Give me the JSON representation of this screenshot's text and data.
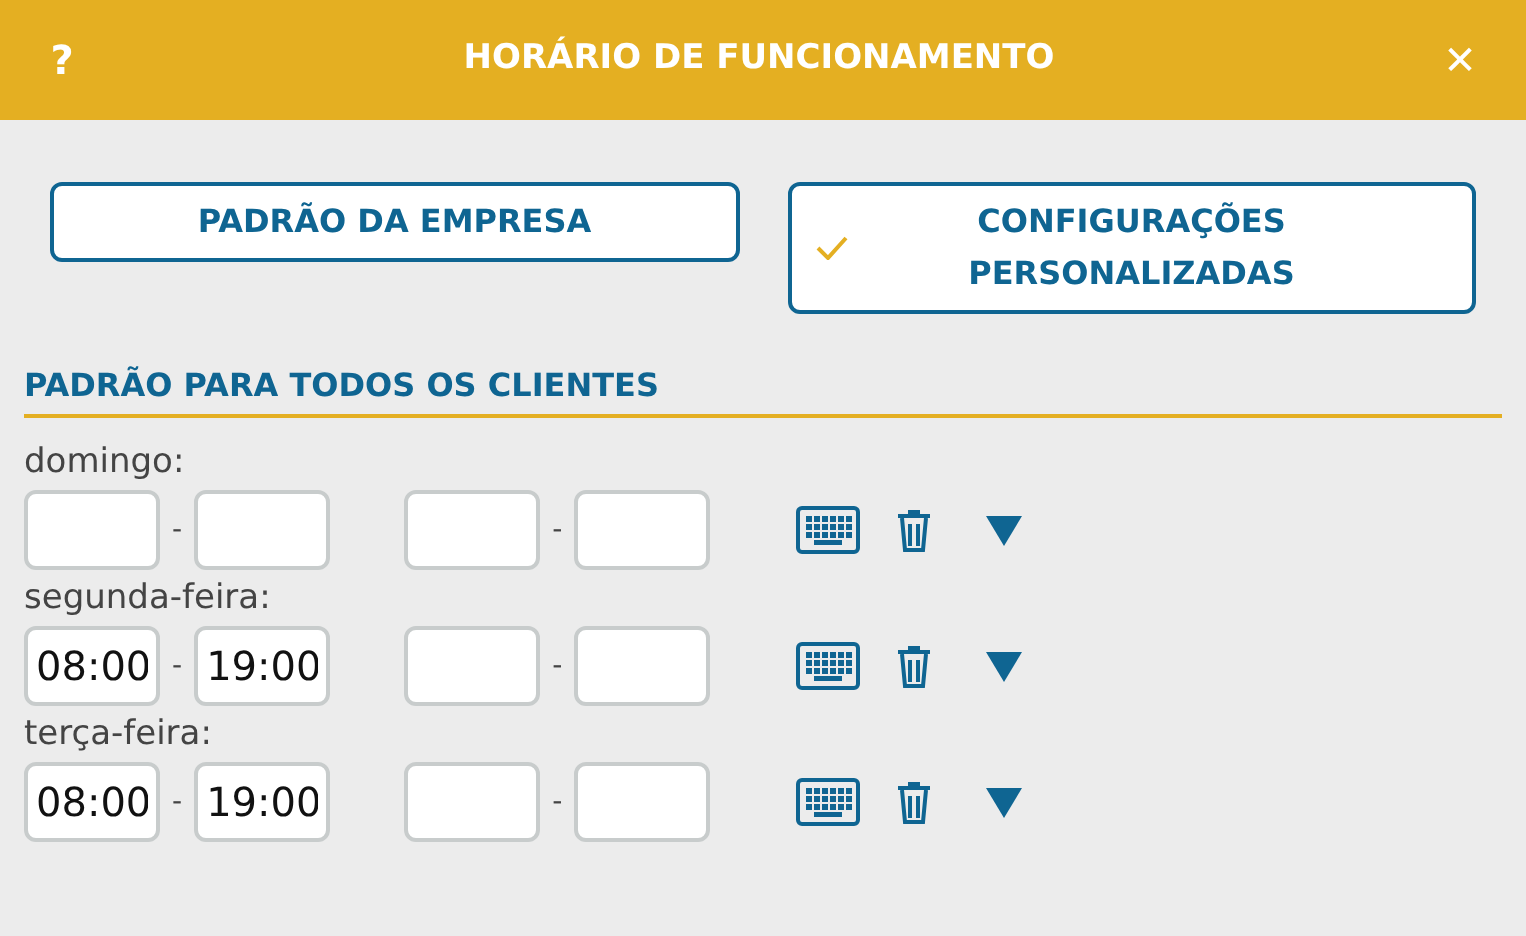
{
  "window": {
    "help": "?",
    "title": "HORÁRIO DE FUNCIONAMENTO",
    "close": "✕"
  },
  "modes": [
    {
      "label": "PADRÃO DA EMPRESA",
      "selected": false
    },
    {
      "label": "CONFIGURAÇÕES PERSONALIZADAS",
      "selected": true
    }
  ],
  "section_title": "PADRÃO PARA TODOS OS CLIENTES",
  "days": [
    {
      "label": "domingo:",
      "slots": [
        {
          "separator": "-"
        },
        {
          "separator": "-"
        }
      ]
    },
    {
      "label": "segunda-feira:",
      "slots": [
        {
          "start": "08:00",
          "separator": "-",
          "end": "19:00"
        },
        {
          "separator": "-"
        }
      ]
    },
    {
      "label": "terça-feira:",
      "slots": [
        {
          "start": "08:00",
          "separator": "-",
          "end": "19:00"
        },
        {
          "separator": "-"
        }
      ]
    }
  ]
}
